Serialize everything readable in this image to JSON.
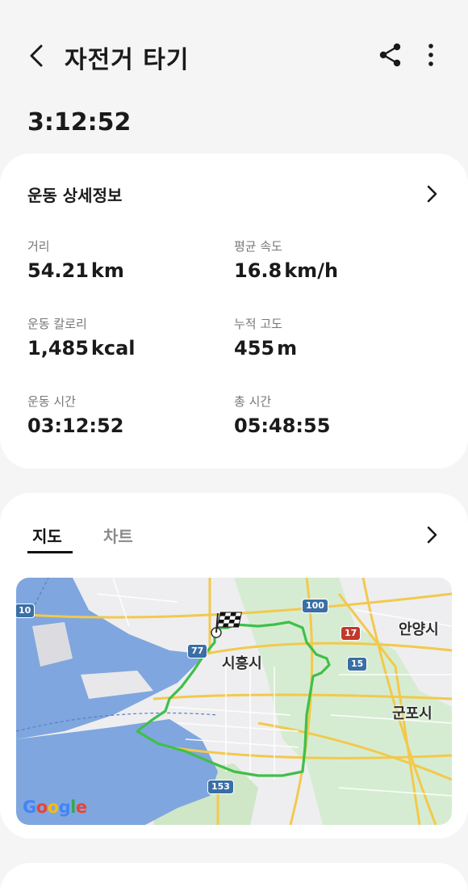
{
  "header": {
    "title": "자전거 타기",
    "back_icon": "chevron-left-icon",
    "share_icon": "share-icon",
    "more_icon": "more-vertical-icon"
  },
  "summary": {
    "duration": "3:12:52"
  },
  "details": {
    "heading": "운동 상세정보",
    "stats": [
      {
        "label": "거리",
        "value": "54.21",
        "unit": "km"
      },
      {
        "label": "평균 속도",
        "value": "16.8",
        "unit": "km/h"
      },
      {
        "label": "운동 칼로리",
        "value": "1,485",
        "unit": "kcal"
      },
      {
        "label": "누적 고도",
        "value": "455",
        "unit": "m"
      },
      {
        "label": "운동 시간",
        "value": "03:12:52",
        "unit": ""
      },
      {
        "label": "총 시간",
        "value": "05:48:55",
        "unit": ""
      }
    ]
  },
  "map_section": {
    "tabs": [
      {
        "label": "지도",
        "active": true
      },
      {
        "label": "차트",
        "active": false
      }
    ],
    "map": {
      "labels": [
        "시흥시",
        "안양시",
        "군포시"
      ],
      "shields": [
        "10",
        "77",
        "100",
        "17",
        "15",
        "153"
      ],
      "attribution": [
        "G",
        "o",
        "o",
        "g",
        "l",
        "e"
      ],
      "route_color": "#3fbf4a",
      "water_color": "#7fa6df"
    }
  }
}
